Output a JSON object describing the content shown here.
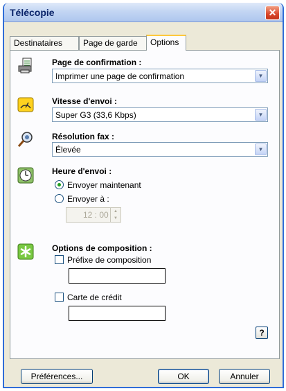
{
  "window": {
    "title": "Télécopie",
    "close_glyph": "✕"
  },
  "tabs": [
    {
      "label": "Destinataires",
      "active": false
    },
    {
      "label": "Page de garde",
      "active": false
    },
    {
      "label": "Options",
      "active": true
    }
  ],
  "confirmation": {
    "label": "Page de confirmation :",
    "value": "Imprimer une page de confirmation",
    "icon": "printer-page-icon"
  },
  "speed": {
    "label": "Vitesse d'envoi :",
    "value": "Super G3 (33,6 Kbps)",
    "icon": "speedometer-icon"
  },
  "resolution": {
    "label": "Résolution fax :",
    "value": "Élevée",
    "icon": "magnifier-icon"
  },
  "send_time": {
    "label": "Heure d'envoi :",
    "icon": "clock-icon",
    "options": [
      {
        "label": "Envoyer maintenant",
        "selected": true
      },
      {
        "label": "Envoyer à :",
        "selected": false
      }
    ],
    "time_value": "12 : 00"
  },
  "dial_options": {
    "label": "Options de composition :",
    "icon": "asterisk-icon",
    "prefix": {
      "label": "Préfixe de composition",
      "checked": false,
      "value": ""
    },
    "credit_card": {
      "label": "Carte de crédit",
      "checked": false,
      "value": ""
    }
  },
  "help_glyph": "?",
  "footer": {
    "preferences_label": "Préférences...",
    "ok_label": "OK",
    "cancel_label": "Annuler"
  },
  "dropdown_glyph": "▼",
  "spin_up_glyph": "▲",
  "spin_down_glyph": "▼"
}
